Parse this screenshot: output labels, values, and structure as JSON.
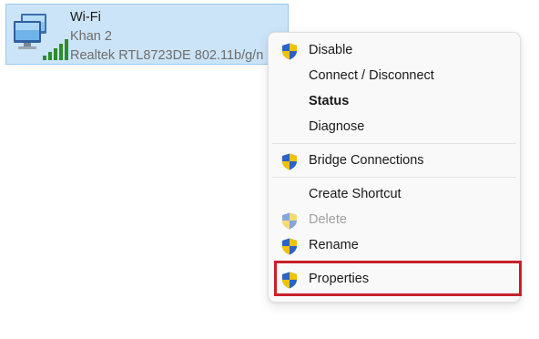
{
  "adapter": {
    "name": "Wi-Fi",
    "network": "Khan 2",
    "device": "Realtek RTL8723DE 802.11b/g/n",
    "icon": "wifi-adapter-icon"
  },
  "menu": {
    "items": [
      {
        "label": "Disable",
        "shield": true,
        "bold": false,
        "disabled": false
      },
      {
        "label": "Connect / Disconnect",
        "shield": false,
        "bold": false,
        "disabled": false
      },
      {
        "label": "Status",
        "shield": false,
        "bold": true,
        "disabled": false
      },
      {
        "label": "Diagnose",
        "shield": false,
        "bold": false,
        "disabled": false
      },
      {
        "label": "Bridge Connections",
        "shield": true,
        "bold": false,
        "disabled": false
      },
      {
        "label": "Create Shortcut",
        "shield": false,
        "bold": false,
        "disabled": false
      },
      {
        "label": "Delete",
        "shield": true,
        "bold": false,
        "disabled": true
      },
      {
        "label": "Rename",
        "shield": true,
        "bold": false,
        "disabled": false
      },
      {
        "label": "Properties",
        "shield": true,
        "bold": false,
        "disabled": false
      }
    ],
    "highlighted_item": "Properties"
  },
  "colors": {
    "selection_bg": "#cce4f7",
    "highlight_border": "#c8202b",
    "shield_blue": "#2a62c8",
    "shield_yellow": "#f2c200"
  }
}
